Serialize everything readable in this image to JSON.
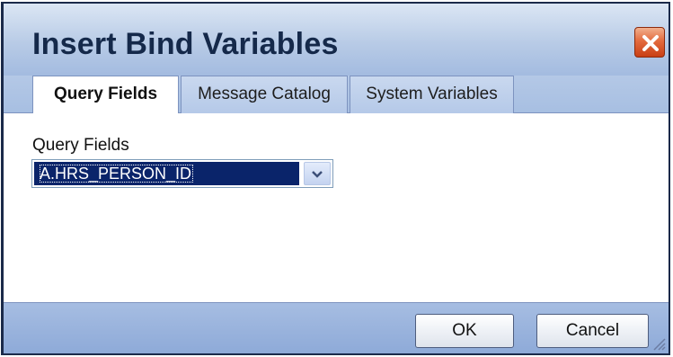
{
  "dialog": {
    "title": "Insert Bind Variables",
    "close_icon": "close-icon",
    "colors": {
      "title_bar": "#b8cbe6",
      "title_text": "#15294a",
      "close_button": "#e36b3e",
      "selection": "#0a246a",
      "footer": "#9bb4de"
    }
  },
  "tabs": [
    {
      "label": "Query Fields",
      "active": true
    },
    {
      "label": "Message Catalog",
      "active": false
    },
    {
      "label": "System Variables",
      "active": false
    }
  ],
  "query_fields": {
    "label": "Query Fields",
    "selected_value": "A.HRS_PERSON_ID",
    "dropdown_icon": "chevron-down-icon"
  },
  "buttons": {
    "ok_label": "OK",
    "cancel_label": "Cancel"
  },
  "resize_icon": "resize-grip-icon"
}
